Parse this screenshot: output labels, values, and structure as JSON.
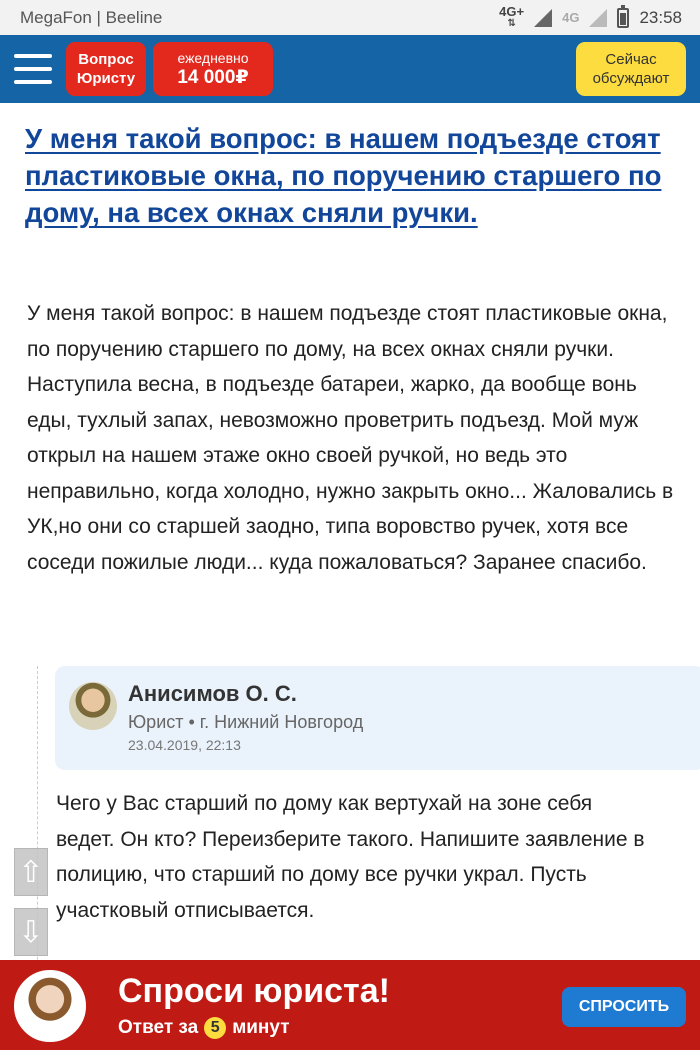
{
  "status_bar": {
    "carrier": "MegaFon | Beeline",
    "network1": "4G+",
    "network2": "4G",
    "time": "23:58"
  },
  "header": {
    "ask_lawyer_label": "Вопрос Юристу",
    "daily_label": "ежедневно",
    "daily_amount": "14 000₽",
    "now_discussing_label": "Сейчас обсуждают",
    "colors": {
      "bar": "#1565a6",
      "red": "#e3281e",
      "yellow": "#fddc3f"
    }
  },
  "question": {
    "title": "У меня такой вопрос: в нашем подъезде стоят пластиковые окна, по поручению старшего по дому, на всех окнах сняли ручки.",
    "body": "У меня такой вопрос: в нашем подъезде стоят пластиковые окна, по поручению старшего по дому, на всех окнах сняли ручки. Наступила весна, в подъезде батареи, жарко, да вообще вонь еды, тухлый запах, невозможно проветрить подъезд. Мой муж открыл на нашем этаже окно своей ручкой, но ведь это неправильно, когда холодно, нужно закрыть окно... Жаловались в УК,но они со старшей заодно, типа воровство ручек, хотя все соседи пожилые люди... куда пожаловаться? Заранее спасибо."
  },
  "answer": {
    "lawyer_name": "Анисимов О. С.",
    "lawyer_meta": "Юрист • г. Нижний Новгород",
    "date": "23.04.2019, 22:13",
    "text": "Чего у Вас старший по дому как вертухай на зоне себя ведет. Он кто? Переизберите такого. Напишите заявление в полицию, что старший по дому все ручки украл. Пусть участковый отписывается."
  },
  "scroll": {
    "up_icon": "⇧",
    "down_icon": "⇩"
  },
  "banner": {
    "title": "Спроси юриста!",
    "sub_before": "Ответ за",
    "minutes": "5",
    "sub_after": "минут",
    "button_label": "СПРОСИТЬ",
    "color": "#c01a14"
  }
}
